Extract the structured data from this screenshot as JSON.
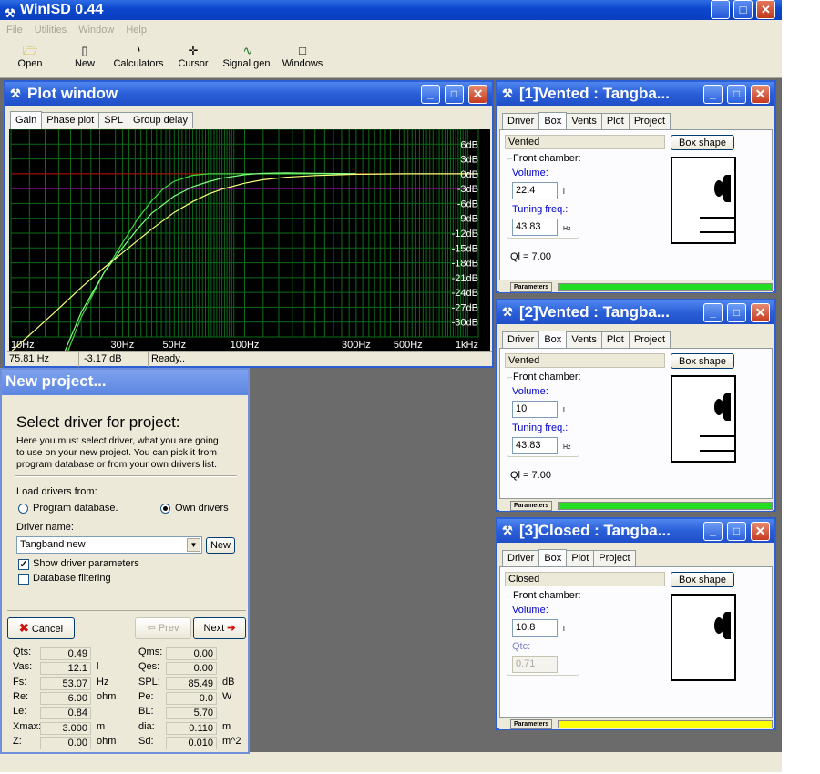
{
  "app": {
    "title": "WinISD 0.44",
    "menu": [
      "File",
      "Utilities",
      "Window",
      "Help"
    ],
    "toolbar": [
      {
        "label": "Open",
        "icon": "folder-open-icon"
      },
      {
        "label": "New",
        "icon": "new-doc-icon"
      },
      {
        "label": "Calculators",
        "icon": "calculator-icon"
      },
      {
        "label": "Cursor",
        "icon": "cursor-icon"
      },
      {
        "label": "Signal gen.",
        "icon": "signal-gen-icon"
      },
      {
        "label": "Windows",
        "icon": "windows-icon"
      }
    ]
  },
  "plot_window": {
    "title": "Plot window",
    "tabs": [
      "Gain",
      "Phase plot",
      "SPL",
      "Group delay"
    ],
    "active_tab": "Gain",
    "status": {
      "freq": "75.81 Hz",
      "gain": "-3.17 dB",
      "state": "Ready.."
    },
    "colors": {
      "bg": "#000000",
      "grid": "#0e6b18",
      "curve1": "#3fd93f",
      "curve2": "#80ff80",
      "curve3": "#ffff80",
      "ref0": "#c00000",
      "ref3": "#a000a0"
    }
  },
  "chart_data": {
    "type": "line",
    "xscale": "log",
    "xlim": [
      10,
      1000
    ],
    "ylim": [
      -33,
      9
    ],
    "x_tick_labels": [
      "10Hz",
      "30Hz",
      "50Hz",
      "100Hz",
      "300Hz",
      "500Hz",
      "1kHz"
    ],
    "y_tick_labels": [
      "6dB",
      "3dB",
      "0dB",
      "-3dB",
      "-6dB",
      "-9dB",
      "-12dB",
      "-15dB",
      "-18dB",
      "-21dB",
      "-24dB",
      "-27dB",
      "-30dB"
    ],
    "series": [
      {
        "color": "#3fd93f",
        "x": [
          10,
          15,
          20,
          25,
          30,
          35,
          40,
          45,
          50,
          60,
          70,
          80,
          100,
          150,
          200,
          300
        ],
        "y": [
          -66,
          -44,
          -29,
          -20,
          -14,
          -9,
          -5.5,
          -3,
          -1.5,
          -0.3,
          0,
          0,
          0,
          0,
          0,
          0
        ]
      },
      {
        "color": "#80ff80",
        "x": [
          10,
          15,
          20,
          25,
          30,
          35,
          40,
          50,
          60,
          70,
          80,
          100,
          120,
          150,
          200,
          300
        ],
        "y": [
          -62,
          -42,
          -28,
          -20,
          -15,
          -11,
          -8,
          -4.5,
          -2.6,
          -1.6,
          -0.9,
          -0.2,
          0.1,
          0.2,
          0.1,
          0
        ]
      },
      {
        "color": "#ffff80",
        "x": [
          10,
          15,
          20,
          25,
          30,
          40,
          50,
          60,
          70,
          80,
          100,
          120,
          150,
          200,
          300,
          500,
          1000
        ],
        "y": [
          -36,
          -28.5,
          -23,
          -19,
          -16,
          -11.2,
          -7.8,
          -5.6,
          -4.1,
          -3.1,
          -1.9,
          -1.2,
          -0.7,
          -0.35,
          -0.1,
          0,
          0
        ]
      }
    ]
  },
  "box_windows": [
    {
      "title": "[1]Vented : Tangba...",
      "tabs": [
        "Driver",
        "Box",
        "Vents",
        "Plot",
        "Project"
      ],
      "active_tab": "Box",
      "box_type": "Vented",
      "box_shape_label": "Box shape",
      "front_chamber": "Front chamber:",
      "vol_label": "Volume:",
      "vol_value": "22.4",
      "vol_unit": "l",
      "tune_label": "Tuning freq.:",
      "tune_value": "43.83",
      "tune_unit": "Hz",
      "q_text": "Ql = 7.00",
      "params_label": "Parameters",
      "params_color": "#22dd22"
    },
    {
      "title": "[2]Vented : Tangba...",
      "tabs": [
        "Driver",
        "Box",
        "Vents",
        "Plot",
        "Project"
      ],
      "active_tab": "Box",
      "box_type": "Vented",
      "box_shape_label": "Box shape",
      "front_chamber": "Front chamber:",
      "vol_label": "Volume:",
      "vol_value": "10",
      "vol_unit": "l",
      "tune_label": "Tuning freq.:",
      "tune_value": "43.83",
      "tune_unit": "Hz",
      "q_text": "Ql = 7.00",
      "params_label": "Parameters",
      "params_color": "#22dd22"
    },
    {
      "title": "[3]Closed : Tangba...",
      "tabs": [
        "Driver",
        "Box",
        "Plot",
        "Project"
      ],
      "active_tab": "Box",
      "box_type": "Closed",
      "box_shape_label": "Box shape",
      "front_chamber": "Front chamber:",
      "vol_label": "Volume:",
      "vol_value": "10.8",
      "vol_unit": "l",
      "tune_label": "Qtc:",
      "tune_value": "0.71",
      "tune_unit": "",
      "q_text": "",
      "params_label": "Parameters",
      "params_color": "#ffff00"
    }
  ],
  "new_project": {
    "title": "New project...",
    "heading": "Select driver for project:",
    "desc_lines": [
      "Here you must select driver, what you are going",
      "to use on your new project. You can pick it from",
      "program database or from your own drivers list."
    ],
    "load_from": "Load drivers from:",
    "opt_program": "Program database.",
    "opt_own": "Own drivers",
    "driver_name_label": "Driver name:",
    "driver_name": "Tangband new",
    "new_btn": "New",
    "show_params": "Show driver parameters",
    "db_filter": "Database filtering",
    "cancel": "Cancel",
    "prev": "Prev",
    "next": "Next",
    "params_left": [
      {
        "k": "Qts:",
        "v": "0.49",
        "u": ""
      },
      {
        "k": "Vas:",
        "v": "12.1",
        "u": "l"
      },
      {
        "k": "Fs:",
        "v": "53.07",
        "u": "Hz"
      },
      {
        "k": "Re:",
        "v": "6.00",
        "u": "ohm"
      },
      {
        "k": "Le:",
        "v": "0.84",
        "u": ""
      },
      {
        "k": "Xmax:",
        "v": "3.000",
        "u": "m"
      },
      {
        "k": "Z:",
        "v": "0.00",
        "u": "ohm"
      }
    ],
    "params_right": [
      {
        "k": "Qms:",
        "v": "0.00",
        "u": ""
      },
      {
        "k": "Qes:",
        "v": "0.00",
        "u": ""
      },
      {
        "k": "SPL:",
        "v": "85.49",
        "u": "dB"
      },
      {
        "k": "Pe:",
        "v": "0.0",
        "u": "W"
      },
      {
        "k": "BL:",
        "v": "5.70",
        "u": ""
      },
      {
        "k": "dia:",
        "v": "0.110",
        "u": "m"
      },
      {
        "k": "Sd:",
        "v": "0.010",
        "u": "m^2"
      }
    ]
  }
}
